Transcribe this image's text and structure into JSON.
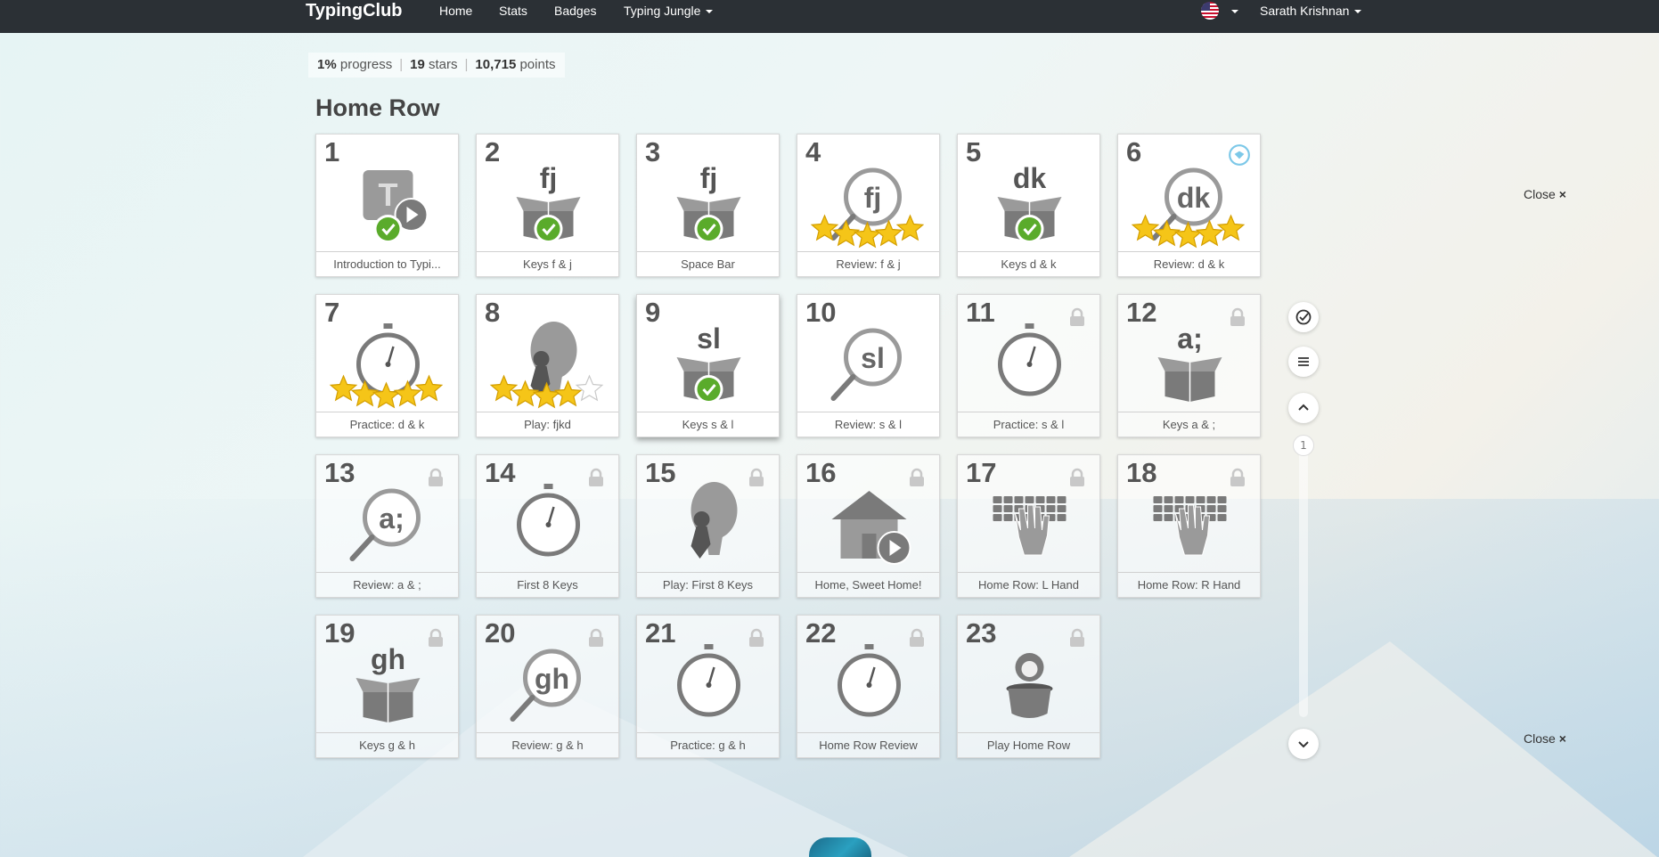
{
  "nav": {
    "brand": "TypingClub",
    "links": [
      "Home",
      "Stats",
      "Badges",
      "Typing Jungle"
    ],
    "user": "Sarath Krishnan"
  },
  "stats": {
    "progress_value": "1%",
    "progress_label": "progress",
    "stars_value": "19",
    "stars_label": "stars",
    "points_value": "10,715",
    "points_label": "points"
  },
  "section_title": "Home Row",
  "lessons": [
    {
      "num": "1",
      "label": "Introduction to Typi...",
      "icon": "video-intro-icon",
      "status": "completed"
    },
    {
      "num": "2",
      "label": "Keys f & j",
      "icon": "box-icon",
      "keys": "fj",
      "status": "completed"
    },
    {
      "num": "3",
      "label": "Space Bar",
      "icon": "box-icon",
      "keys": "fj",
      "status": "completed"
    },
    {
      "num": "4",
      "label": "Review: f & j",
      "icon": "magnifier-icon",
      "keys": "fj",
      "stars": 5
    },
    {
      "num": "5",
      "label": "Keys d & k",
      "icon": "box-icon",
      "keys": "dk",
      "status": "completed"
    },
    {
      "num": "6",
      "label": "Review: d & k",
      "icon": "magnifier-icon",
      "keys": "dk",
      "stars": 5,
      "badge": "laurel-badge-icon"
    },
    {
      "num": "7",
      "label": "Practice: d & k",
      "icon": "stopwatch-icon",
      "stars": 5
    },
    {
      "num": "8",
      "label": "Play: fjkd",
      "icon": "balloon-game-icon",
      "stars": 4
    },
    {
      "num": "9",
      "label": "Keys s & l",
      "icon": "box-icon",
      "keys": "sl",
      "status": "completed"
    },
    {
      "num": "10",
      "label": "Review: s & l",
      "icon": "magnifier-icon",
      "keys": "sl"
    },
    {
      "num": "11",
      "label": "Practice: s & l",
      "icon": "stopwatch-icon",
      "status": "locked"
    },
    {
      "num": "12",
      "label": "Keys a & ;",
      "icon": "box-icon",
      "keys": "a;",
      "status": "locked"
    },
    {
      "num": "13",
      "label": "Review: a & ;",
      "icon": "magnifier-icon",
      "keys": "a;",
      "status": "locked"
    },
    {
      "num": "14",
      "label": "First 8 Keys",
      "icon": "stopwatch-icon",
      "status": "locked"
    },
    {
      "num": "15",
      "label": "Play: First 8 Keys",
      "icon": "balloon-game-icon",
      "status": "locked"
    },
    {
      "num": "16",
      "label": "Home, Sweet Home!",
      "icon": "house-video-icon",
      "status": "locked"
    },
    {
      "num": "17",
      "label": "Home Row: L Hand",
      "icon": "keyboard-hand-icon",
      "status": "locked"
    },
    {
      "num": "18",
      "label": "Home Row: R Hand",
      "icon": "keyboard-hand-icon",
      "status": "locked"
    },
    {
      "num": "19",
      "label": "Keys g & h",
      "icon": "box-icon",
      "keys": "gh",
      "status": "locked"
    },
    {
      "num": "20",
      "label": "Review: g & h",
      "icon": "magnifier-icon",
      "keys": "gh",
      "status": "locked"
    },
    {
      "num": "21",
      "label": "Practice: g & h",
      "icon": "stopwatch-icon",
      "status": "locked"
    },
    {
      "num": "22",
      "label": "Home Row Review",
      "icon": "stopwatch-icon",
      "status": "locked"
    },
    {
      "num": "23",
      "label": "Play Home Row",
      "icon": "pot-game-icon",
      "status": "locked"
    }
  ],
  "side": {
    "page_number": "1",
    "close_label": "Close",
    "close_symbol": "×"
  },
  "colors": {
    "nav_bg": "#2b3035",
    "check_green": "#5aab2b",
    "star_gold": "#f5c518",
    "icon_gray": "#777777"
  }
}
